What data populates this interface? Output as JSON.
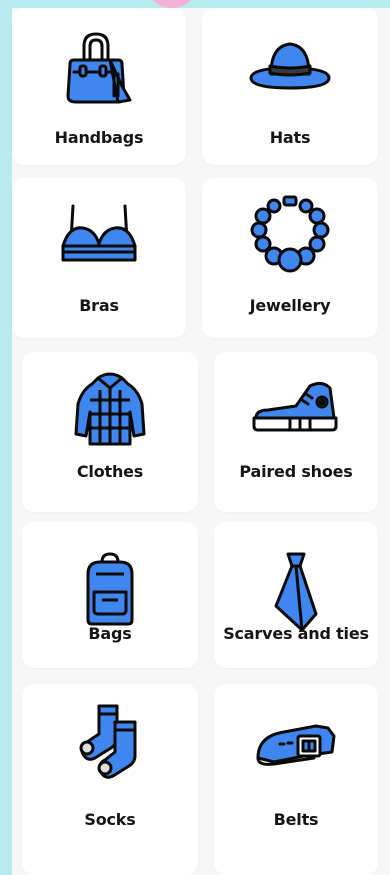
{
  "categories": [
    {
      "label": "Handbags",
      "icon": "handbag-icon"
    },
    {
      "label": "Hats",
      "icon": "hat-icon"
    },
    {
      "label": "Bras",
      "icon": "bra-icon"
    },
    {
      "label": "Jewellery",
      "icon": "necklace-icon"
    },
    {
      "label": "Clothes",
      "icon": "jacket-icon"
    },
    {
      "label": "Paired shoes",
      "icon": "sneaker-icon"
    },
    {
      "label": "Bags",
      "icon": "backpack-icon"
    },
    {
      "label": "Scarves and ties",
      "icon": "tie-icon"
    },
    {
      "label": "Socks",
      "icon": "socks-icon"
    },
    {
      "label": "Belts",
      "icon": "belt-icon"
    }
  ],
  "colors": {
    "icon_fill": "#3f86ee",
    "icon_stroke": "#0a0a0a",
    "background": "#b7ebf0",
    "card": "#ffffff"
  }
}
